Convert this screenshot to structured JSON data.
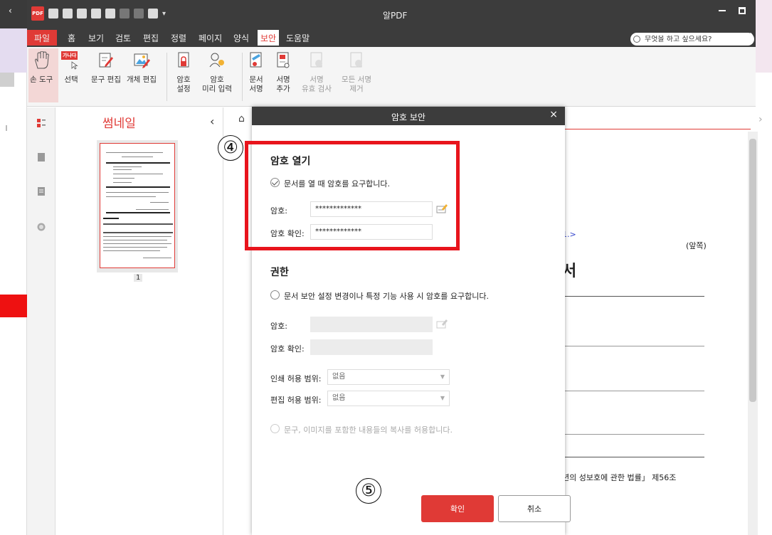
{
  "app": {
    "title": "알PDF",
    "logo_text": "PDF"
  },
  "menubar": {
    "items": [
      "파일",
      "홈",
      "보기",
      "검토",
      "편집",
      "정렬",
      "페이지",
      "양식",
      "보안",
      "도움말"
    ],
    "active": "보안",
    "search_placeholder": "무엇을 하고 싶으세요?"
  },
  "ribbon": {
    "hand_tool": "손 도구",
    "select": "선택",
    "select_badge": "가나다",
    "text_edit": "문구 편집",
    "object_edit": "개체 편집",
    "password_setup": [
      "암호",
      "설정"
    ],
    "password_preset": [
      "암호",
      "미리 입력"
    ],
    "doc_sign": [
      "문서",
      "서명"
    ],
    "sign_add": [
      "서명",
      "추가"
    ],
    "sign_validate": [
      "서명",
      "유효 검사"
    ],
    "sign_remove_all": [
      "모든 서명",
      "제거"
    ]
  },
  "thumbnails": {
    "title": "썸네일",
    "page_number": "1"
  },
  "document": {
    "link_text": "1.>",
    "front_label": "(앞쪽)",
    "heading_char": "서",
    "law_text": "년의 성보호에 관한 법률」 제56조"
  },
  "dialog": {
    "title": "암호 보안",
    "open_section": {
      "title": "암호 열기",
      "require_label": "문서를 열 때 암호를 요구합니다.",
      "require_checked": true,
      "password_label": "암호:",
      "password_value": "*************",
      "confirm_label": "암호 확인:",
      "confirm_value": "*************"
    },
    "permission_section": {
      "title": "권한",
      "require_label": "문서 보안 설정 변경이나 특정 기능 사용 시 암호를 요구합니다.",
      "require_checked": false,
      "password_label": "암호:",
      "confirm_label": "암호 확인:",
      "print_label": "인쇄 허용 범위:",
      "print_value": "없음",
      "edit_label": "편집 허용 범위:",
      "edit_value": "없음",
      "copy_label": "문구, 이미지를 포함한 내용들의 복사를 허용합니다."
    },
    "ok_label": "확인",
    "cancel_label": "취소"
  },
  "annotations": {
    "step4": "④",
    "step5": "⑤",
    "highlight_color": "#e8141c",
    "accent_color": "#e03a36"
  }
}
